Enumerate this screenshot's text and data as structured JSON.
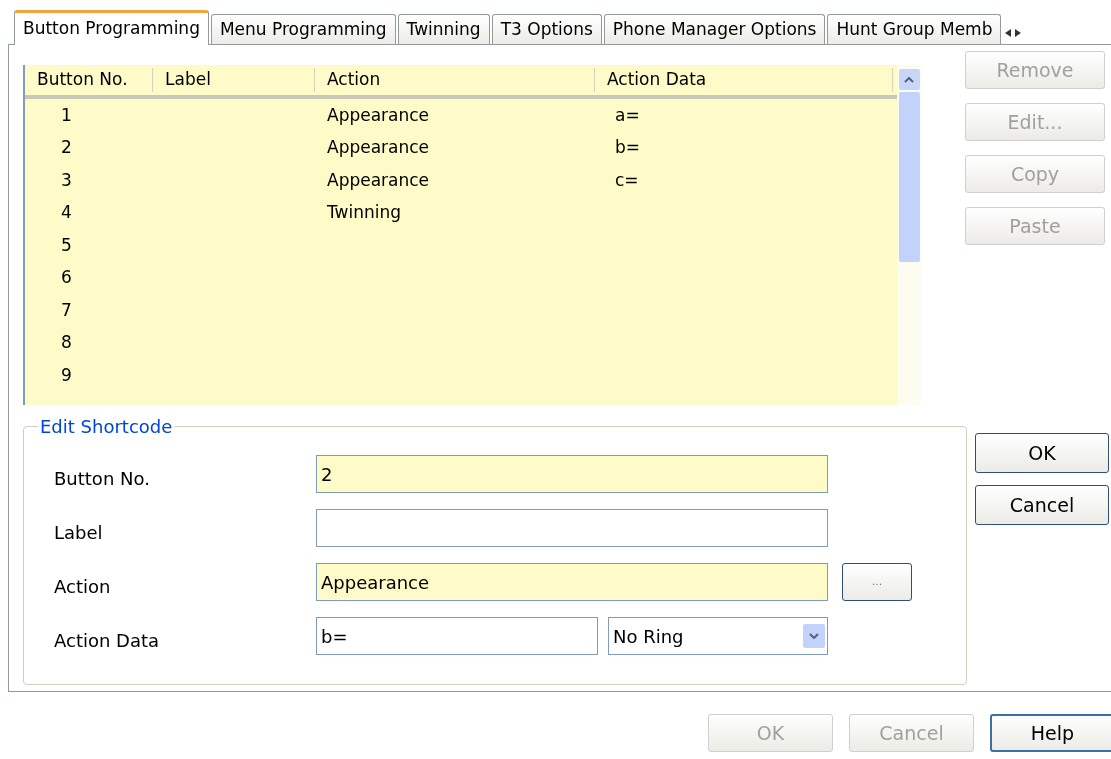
{
  "tabs": [
    {
      "label": "Button Programming",
      "selected": true
    },
    {
      "label": "Menu Programming",
      "selected": false
    },
    {
      "label": "Twinning",
      "selected": false
    },
    {
      "label": "T3 Options",
      "selected": false
    },
    {
      "label": "Phone Manager Options",
      "selected": false
    },
    {
      "label": "Hunt Group Memb",
      "selected": false
    }
  ],
  "table": {
    "columns": [
      "Button No.",
      "Label",
      "Action",
      "Action Data"
    ],
    "rows": [
      [
        "1",
        "",
        "Appearance",
        "a="
      ],
      [
        "2",
        "",
        "Appearance",
        "b="
      ],
      [
        "3",
        "",
        "Appearance",
        "c="
      ],
      [
        "4",
        "",
        "Twinning",
        ""
      ],
      [
        "5",
        "",
        "",
        ""
      ],
      [
        "6",
        "",
        "",
        ""
      ],
      [
        "7",
        "",
        "",
        ""
      ],
      [
        "8",
        "",
        "",
        ""
      ],
      [
        "9",
        "",
        "",
        ""
      ]
    ]
  },
  "side_buttons": [
    {
      "label": "Remove",
      "disabled": true
    },
    {
      "label": "Edit...",
      "disabled": true
    },
    {
      "label": "Copy",
      "disabled": true
    },
    {
      "label": "Paste",
      "disabled": true
    }
  ],
  "edit_shortcode": {
    "title": "Edit Shortcode",
    "fields": [
      {
        "label": "Button No.",
        "value": "2",
        "kind": "text",
        "highlighted": true
      },
      {
        "label": "Label",
        "kind": "text",
        "highlighted": false
      },
      {
        "label": "Action",
        "value": "Appearance",
        "kind": "browse",
        "highlighted": true,
        "button": "..."
      },
      {
        "label": "Action Data",
        "value": "b=",
        "kind": "combo",
        "highlighted": false,
        "option": "No Ring"
      }
    ]
  },
  "dialog_buttons": [
    {
      "label": "OK",
      "disabled": false
    },
    {
      "label": "Cancel",
      "disabled": false
    }
  ],
  "footer_buttons": [
    {
      "label": "OK",
      "disabled": true
    },
    {
      "label": "Cancel",
      "disabled": true
    },
    {
      "label": "Help",
      "disabled": false,
      "default": true
    }
  ]
}
